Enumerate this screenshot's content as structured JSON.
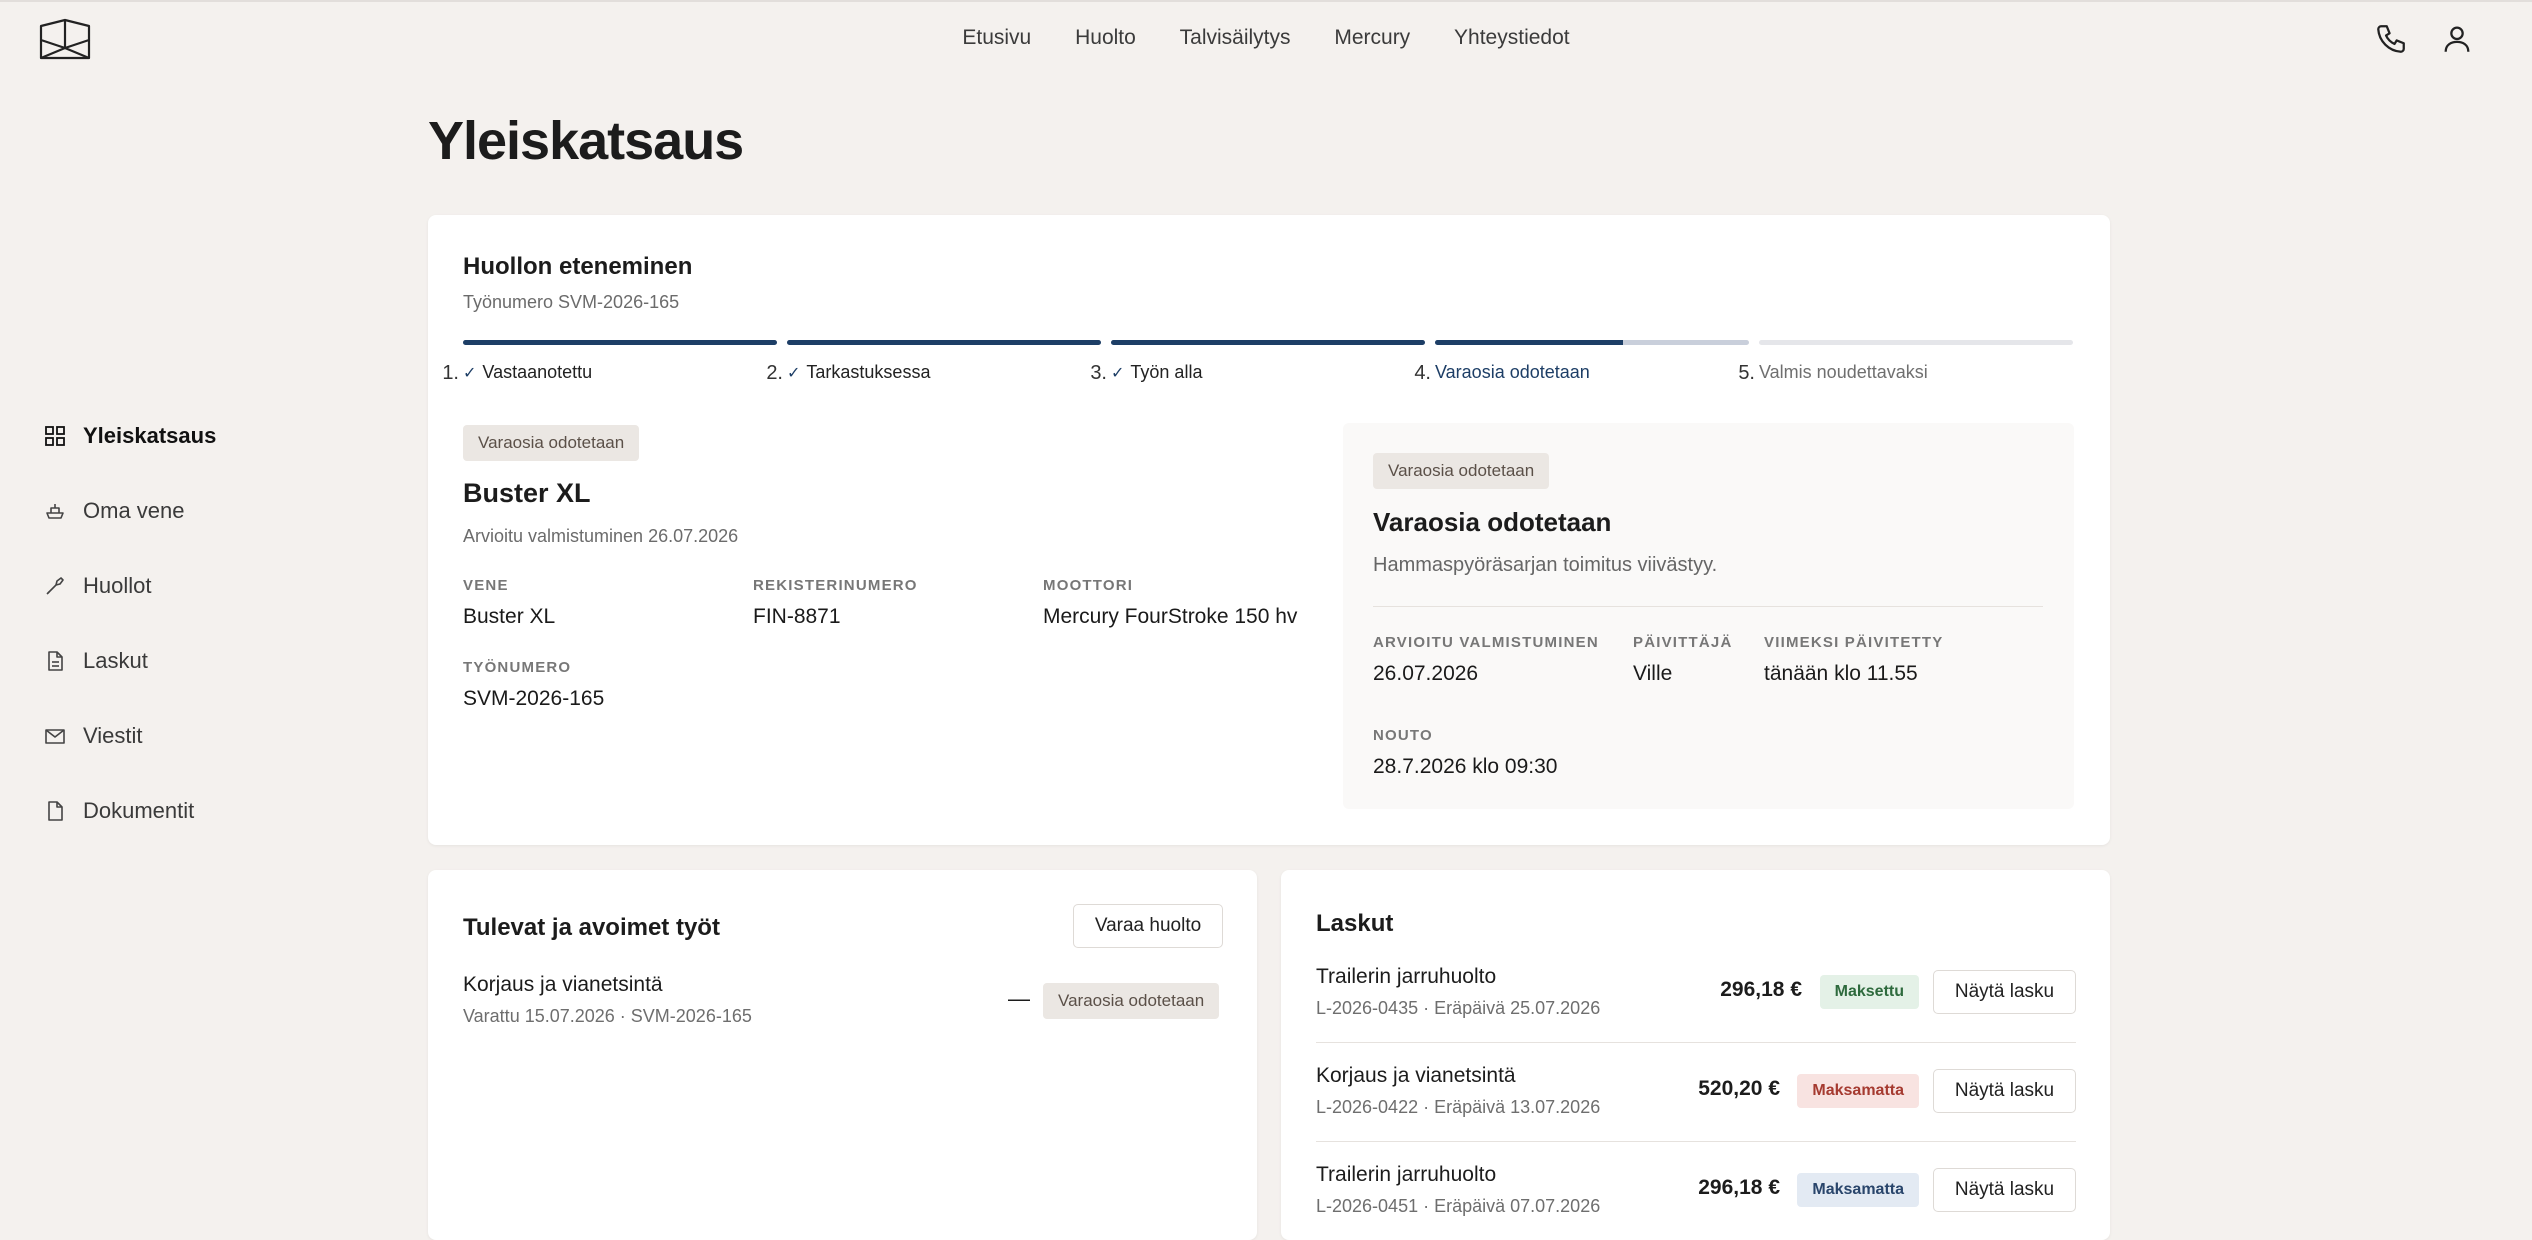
{
  "topnav": {
    "items": [
      "Etusivu",
      "Huolto",
      "Talvisäilytys",
      "Mercury",
      "Yhteystiedot"
    ]
  },
  "sidebar": {
    "items": [
      {
        "label": "Yleiskatsaus",
        "icon": "grid-icon",
        "active": true
      },
      {
        "label": "Oma vene",
        "icon": "boat-icon"
      },
      {
        "label": "Huollot",
        "icon": "wrench-icon"
      },
      {
        "label": "Laskut",
        "icon": "invoice-icon"
      },
      {
        "label": "Viestit",
        "icon": "mail-icon"
      },
      {
        "label": "Dokumentit",
        "icon": "document-icon"
      }
    ]
  },
  "page": {
    "title": "Yleiskatsaus"
  },
  "progress": {
    "title": "Huollon eteneminen",
    "job_number": "Työnumero SVM-2026-165",
    "steps": [
      {
        "num": "1.",
        "label": "Vastaanotettu",
        "state": "done",
        "fill": 1.0
      },
      {
        "num": "2.",
        "label": "Tarkastuksessa",
        "state": "done",
        "fill": 1.0
      },
      {
        "num": "3.",
        "label": "Työn alla",
        "state": "done",
        "fill": 1.0
      },
      {
        "num": "4.",
        "label": "Varaosia odotetaan",
        "state": "current",
        "fill": 0.6
      },
      {
        "num": "5.",
        "label": "Valmis noudettavaksi",
        "state": "todo",
        "fill": 0
      }
    ]
  },
  "boat": {
    "badge": "Varaosia odotetaan",
    "name": "Buster XL",
    "estimate": "Arvioitu valmistuminen 26.07.2026",
    "vene_label": "VENE",
    "vene": "Buster XL",
    "reg_label": "REKISTERINUMERO",
    "reg": "FIN-8871",
    "engine_label": "MOOTTORI",
    "engine": "Mercury FourStroke 150 hv",
    "job_label": "TYÖNUMERO",
    "job": "SVM-2026-165"
  },
  "status": {
    "badge": "Varaosia odotetaan",
    "title": "Varaosia odotetaan",
    "description": "Hammaspyöräsarjan toimitus viivästyy.",
    "est_label": "ARVIOITU VALMISTUMINEN",
    "est": "26.07.2026",
    "updater_label": "PÄIVITTÄJÄ",
    "updater": "Ville",
    "updated_label": "VIIMEKSI PÄIVITETTY",
    "updated": "tänään klo 11.55",
    "pickup_label": "NOUTO",
    "pickup": "28.7.2026 klo 09:30"
  },
  "jobs": {
    "title": "Tulevat ja avoimet työt",
    "book_button": "Varaa huolto",
    "items": [
      {
        "title": "Korjaus ja vianetsintä",
        "meta": "Varattu 15.07.2026 · SVM-2026-165",
        "amount": "—",
        "badge": "Varaosia odotetaan"
      }
    ]
  },
  "invoices": {
    "title": "Laskut",
    "view_button": "Näytä lasku",
    "items": [
      {
        "title": "Trailerin jarruhuolto",
        "meta": "L-2026-0435 · Eräpäivä 25.07.2026",
        "amount": "296,18 €",
        "status": "Maksettu",
        "status_color": "green"
      },
      {
        "title": "Korjaus ja vianetsintä",
        "meta": "L-2026-0422 · Eräpäivä 13.07.2026",
        "amount": "520,20 €",
        "status": "Maksamatta",
        "status_color": "red"
      },
      {
        "title": "Trailerin jarruhuolto",
        "meta": "L-2026-0451 · Eräpäivä 07.07.2026",
        "amount": "296,18 €",
        "status": "Maksamatta",
        "status_color": "blue"
      }
    ]
  }
}
